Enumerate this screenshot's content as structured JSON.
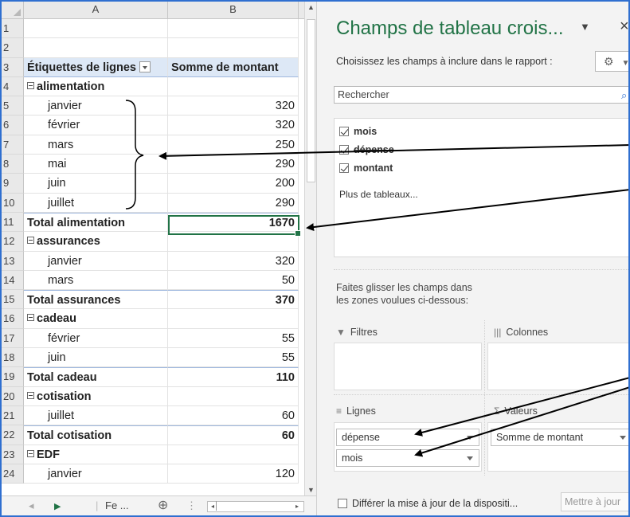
{
  "spreadsheet": {
    "columns": [
      "A",
      "B"
    ],
    "rows": [
      {
        "num": "1",
        "a": "",
        "b": "",
        "kind": "blank"
      },
      {
        "num": "2",
        "a": "",
        "b": "",
        "kind": "blank"
      },
      {
        "num": "3",
        "a": "Étiquettes de lignes",
        "b": "Somme de montant",
        "kind": "header"
      },
      {
        "num": "4",
        "a": "alimentation",
        "b": "",
        "kind": "group"
      },
      {
        "num": "5",
        "a": "janvier",
        "b": "320",
        "kind": "item"
      },
      {
        "num": "6",
        "a": "février",
        "b": "320",
        "kind": "item"
      },
      {
        "num": "7",
        "a": "mars",
        "b": "250",
        "kind": "item"
      },
      {
        "num": "8",
        "a": "mai",
        "b": "290",
        "kind": "item"
      },
      {
        "num": "9",
        "a": "juin",
        "b": "200",
        "kind": "item"
      },
      {
        "num": "10",
        "a": "juillet",
        "b": "290",
        "kind": "item"
      },
      {
        "num": "11",
        "a": "Total alimentation",
        "b": "1670",
        "kind": "total"
      },
      {
        "num": "12",
        "a": "assurances",
        "b": "",
        "kind": "group"
      },
      {
        "num": "13",
        "a": "janvier",
        "b": "320",
        "kind": "item"
      },
      {
        "num": "14",
        "a": "mars",
        "b": "50",
        "kind": "item"
      },
      {
        "num": "15",
        "a": "Total assurances",
        "b": "370",
        "kind": "total"
      },
      {
        "num": "16",
        "a": "cadeau",
        "b": "",
        "kind": "group"
      },
      {
        "num": "17",
        "a": "février",
        "b": "55",
        "kind": "item"
      },
      {
        "num": "18",
        "a": "juin",
        "b": "55",
        "kind": "item"
      },
      {
        "num": "19",
        "a": "Total cadeau",
        "b": "110",
        "kind": "total"
      },
      {
        "num": "20",
        "a": "cotisation",
        "b": "",
        "kind": "group"
      },
      {
        "num": "21",
        "a": "juillet",
        "b": "60",
        "kind": "item"
      },
      {
        "num": "22",
        "a": "Total cotisation",
        "b": "60",
        "kind": "total"
      },
      {
        "num": "23",
        "a": "EDF",
        "b": "",
        "kind": "group"
      },
      {
        "num": "24",
        "a": "janvier",
        "b": "120",
        "kind": "item"
      }
    ],
    "sheet_tab": "Fe ...",
    "selected_cell": "B11"
  },
  "pivot_pane": {
    "title": "Champs de tableau crois...",
    "choose_label": "Choisissez les champs à inclure dans le rapport :",
    "search_placeholder": "Rechercher",
    "fields": [
      {
        "name": "mois",
        "checked": true,
        "struck": false
      },
      {
        "name": "dépense",
        "checked": true,
        "struck": true
      },
      {
        "name": "montant",
        "checked": true,
        "struck": false
      }
    ],
    "more_tables": "Plus de tableaux...",
    "drag_text": "Faites glisser les champs dans les zones voulues ci-dessous:",
    "zones": {
      "filters": "Filtres",
      "columns": "Colonnes",
      "rows": "Lignes",
      "values": "Valeurs"
    },
    "row_chips": [
      "dépense",
      "mois"
    ],
    "value_chips": [
      "Somme de montant"
    ],
    "defer_label": "Différer la mise à jour de la dispositi...",
    "update_button": "Mettre à jour"
  },
  "icons": {
    "gear": "⚙",
    "search": "⌕",
    "close": "×",
    "add_sheet": "⊕"
  }
}
